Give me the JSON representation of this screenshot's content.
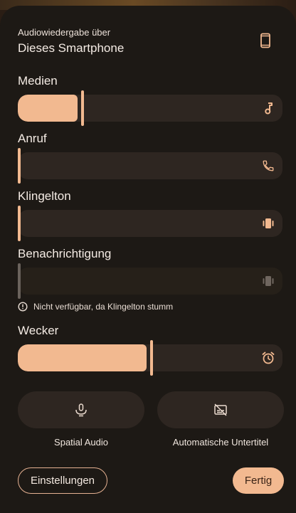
{
  "output": {
    "caption": "Audiowiedergabe über",
    "device": "Dieses Smartphone"
  },
  "sliders": {
    "media": {
      "label": "Medien",
      "level": 0.24,
      "icon": "music-note-icon"
    },
    "call": {
      "label": "Anruf",
      "level": 0.0,
      "icon": "phone-icon"
    },
    "ring": {
      "label": "Klingelton",
      "level": 0.0,
      "icon": "vibrate-icon"
    },
    "notification": {
      "label": "Benachrichtigung",
      "level": 0.0,
      "icon": "vibrate-icon",
      "disabled": true
    },
    "alarm": {
      "label": "Wecker",
      "level": 0.5,
      "icon": "alarm-icon"
    }
  },
  "notice": "Nicht verfügbar, da Klingelton stumm",
  "toggles": {
    "spatial_audio": "Spatial Audio",
    "live_caption": "Automatische Untertitel"
  },
  "footer": {
    "settings": "Einstellungen",
    "done": "Fertig"
  },
  "colors": {
    "accent": "#f2b990",
    "panel": "#1d1915",
    "track": "#2e2621"
  }
}
